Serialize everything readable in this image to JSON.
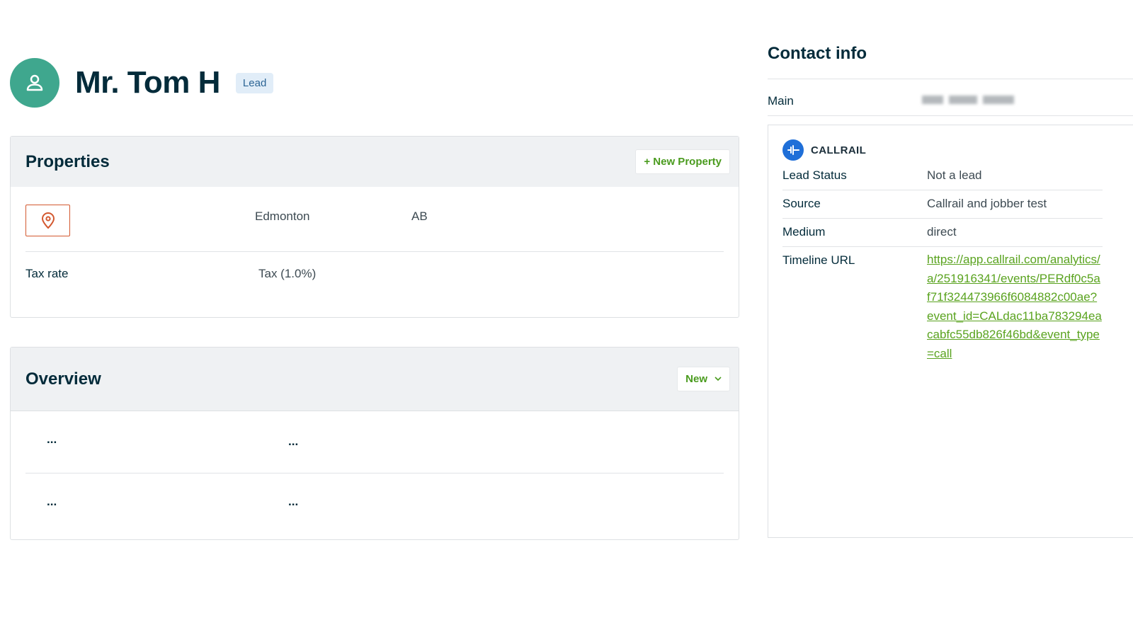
{
  "client": {
    "name": "Mr. Tom H",
    "badge": "Lead"
  },
  "properties": {
    "title": "Properties",
    "new_button": "+ New Property",
    "address": {
      "city": "Edmonton",
      "province": "AB"
    },
    "tax": {
      "label": "Tax rate",
      "value": "Tax (1.0%)"
    }
  },
  "overview": {
    "title": "Overview",
    "new_button": "New",
    "rows": [
      [
        "...",
        "..."
      ],
      [
        "...",
        "..."
      ]
    ]
  },
  "contact": {
    "title": "Contact info",
    "main_label": "Main"
  },
  "callrail": {
    "brand": "CALLRAIL",
    "fields": [
      {
        "key": "Lead Status",
        "value": "Not a lead"
      },
      {
        "key": "Source",
        "value": "Callrail and jobber test"
      },
      {
        "key": "Medium",
        "value": "direct"
      },
      {
        "key": "Timeline URL",
        "value": "https://app.callrail.com/analytics/a/251916341/events/PERdf0c5af71f324473966f6084882c00ae?event_id=CALdac11ba783294eacabfc55db826f46bd&event_type=call"
      }
    ]
  },
  "colors": {
    "avatar": "#3fa78e",
    "brand_green": "#5aa31f",
    "pin": "#d3582f",
    "callrail_blue": "#1f6fd8"
  }
}
